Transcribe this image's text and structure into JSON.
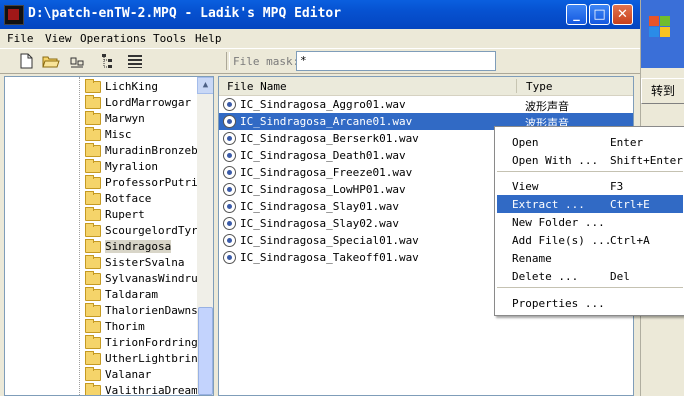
{
  "window": {
    "title": "D:\\patch-enTW-2.MPQ - Ladik's MPQ Editor"
  },
  "titlebar_buttons": {
    "minimize": "_",
    "maximize": "□",
    "close": "✕"
  },
  "desktop": {
    "button_label": "转到"
  },
  "menu": [
    "File",
    "View",
    "Operations",
    "Tools",
    "Help"
  ],
  "toolbar": {
    "icons": [
      "new-file-icon",
      "open-folder-icon",
      "rename-icon",
      "tree-view-icon",
      "list-view-icon"
    ],
    "file_mask_label": "File mask:",
    "file_mask_value": "*"
  },
  "tree": {
    "items": [
      "LichKing",
      "LordMarrowgar",
      "Marwyn",
      "Misc",
      "MuradinBronzebe",
      "Myralion",
      "ProfessorPutric",
      "Rotface",
      "Rupert",
      "ScourgelordTyra",
      "Sindragosa",
      "SisterSvalna",
      "SylvanasWindrun",
      "Taldaram",
      "ThalorienDawnse",
      "Thorim",
      "TirionFordring",
      "UtherLightbring",
      "Valanar",
      "ValithriaDreamw"
    ],
    "selected": "Sindragosa"
  },
  "list": {
    "columns": [
      "File Name",
      "Type"
    ],
    "rows": [
      {
        "name": "IC_Sindragosa_Aggro01.wav",
        "type": "波形声音"
      },
      {
        "name": "IC_Sindragosa_Arcane01.wav",
        "type": "波形声音"
      },
      {
        "name": "IC_Sindragosa_Berserk01.wav",
        "type": ""
      },
      {
        "name": "IC_Sindragosa_Death01.wav",
        "type": ""
      },
      {
        "name": "IC_Sindragosa_Freeze01.wav",
        "type": ""
      },
      {
        "name": "IC_Sindragosa_LowHP01.wav",
        "type": ""
      },
      {
        "name": "IC_Sindragosa_Slay01.wav",
        "type": ""
      },
      {
        "name": "IC_Sindragosa_Slay02.wav",
        "type": ""
      },
      {
        "name": "IC_Sindragosa_Special01.wav",
        "type": ""
      },
      {
        "name": "IC_Sindragosa_Takeoff01.wav",
        "type": ""
      }
    ],
    "selected_index": 1
  },
  "context_menu": {
    "items": [
      {
        "label": "Open",
        "shortcut": "Enter"
      },
      {
        "label": "Open With ...",
        "shortcut": "Shift+Enter"
      },
      {
        "label": "View",
        "shortcut": "F3"
      },
      {
        "label": "Extract ...",
        "shortcut": "Ctrl+E"
      },
      {
        "label": "New Folder ...",
        "shortcut": ""
      },
      {
        "label": "Add File(s) ...",
        "shortcut": "Ctrl+A"
      },
      {
        "label": "Rename",
        "shortcut": ""
      },
      {
        "label": "Delete ...",
        "shortcut": "Del"
      },
      {
        "label": "Properties ...",
        "shortcut": ""
      }
    ],
    "highlighted": "Extract ..."
  },
  "colors": {
    "titlebar": "#0651d0",
    "selection": "#316ac5",
    "folder": "#f5d46a"
  }
}
